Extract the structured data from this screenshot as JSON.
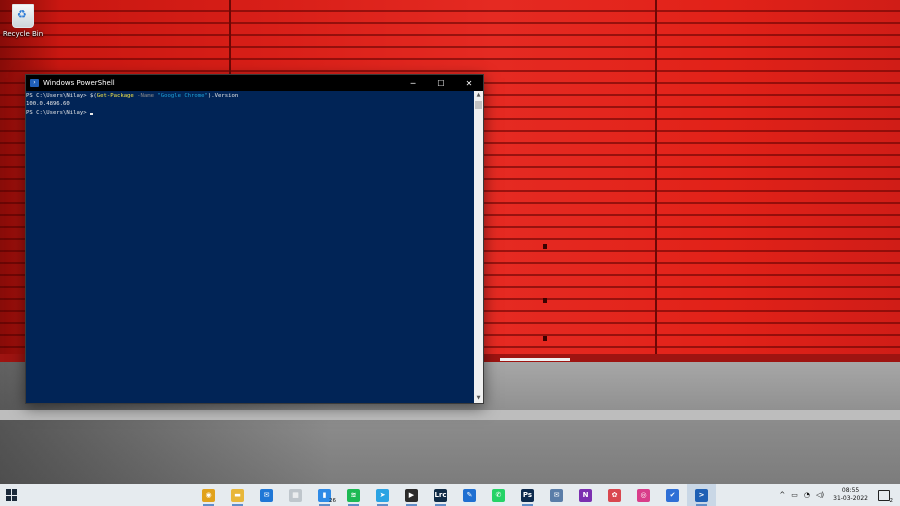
{
  "desktop": {
    "recycle_bin_label": "Recycle Bin"
  },
  "powershell": {
    "title": "Windows PowerShell",
    "controls": {
      "minimize": "─",
      "maximize": "☐",
      "close": "✕"
    },
    "line1": {
      "prompt": "PS C:\\Users\\Nilay> ",
      "pre": "$(",
      "cmdlet": "Get-Package",
      "param": " -Name ",
      "arg": "\"Google Chrome\"",
      "post": ").Version"
    },
    "line2": "100.0.4896.60",
    "line3_prompt": "PS C:\\Users\\Nilay> "
  },
  "taskbar": {
    "apps": [
      {
        "name": "chrome",
        "glyph": "◉",
        "color": "#e1a21c",
        "running": true
      },
      {
        "name": "file-explorer",
        "glyph": "▬",
        "color": "#e8b73a",
        "running": true
      },
      {
        "name": "mail",
        "glyph": "✉",
        "color": "#1f77d6",
        "running": false
      },
      {
        "name": "store",
        "glyph": "▦",
        "color": "#bfc6cc",
        "running": false
      },
      {
        "name": "word-counter",
        "glyph": "▮",
        "color": "#2e8ae6",
        "running": true,
        "badge": "26"
      },
      {
        "name": "spotify",
        "glyph": "≋",
        "color": "#1db954",
        "running": true
      },
      {
        "name": "telegram",
        "glyph": "➤",
        "color": "#2aa3e3",
        "running": true
      },
      {
        "name": "media-player",
        "glyph": "▶",
        "color": "#2b2b2b",
        "running": true
      },
      {
        "name": "lightroom",
        "glyph": "Lrc",
        "color": "#0f2b46",
        "running": true
      },
      {
        "name": "pen-tool",
        "glyph": "✎",
        "color": "#1f6fd1",
        "running": false
      },
      {
        "name": "whatsapp",
        "glyph": "✆",
        "color": "#25d366",
        "running": false
      },
      {
        "name": "photoshop",
        "glyph": "Ps",
        "color": "#0d2a4d",
        "running": true
      },
      {
        "name": "mail-client",
        "glyph": "✉",
        "color": "#5a7da8",
        "running": false
      },
      {
        "name": "onenote",
        "glyph": "N",
        "color": "#7b2fb0",
        "running": false
      },
      {
        "name": "photos",
        "glyph": "✿",
        "color": "#d9474f",
        "running": false
      },
      {
        "name": "instagram",
        "glyph": "◎",
        "color": "#d93d8a",
        "running": false
      },
      {
        "name": "todo",
        "glyph": "✔",
        "color": "#2f6fd6",
        "running": false
      },
      {
        "name": "powershell",
        "glyph": ">",
        "color": "#1e5fb4",
        "running": true,
        "active": true
      }
    ],
    "tray": {
      "chevron": "^",
      "battery": "▭",
      "wifi": "◔",
      "volume": "◁)",
      "time": "08:55",
      "date": "31-03-2022",
      "notifications": "2"
    }
  }
}
